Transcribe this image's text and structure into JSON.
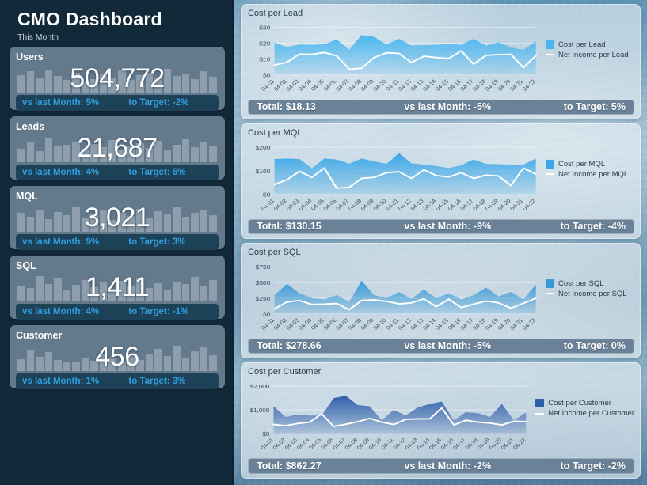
{
  "header": {
    "title": "CMO Dashboard",
    "subtitle": "This Month"
  },
  "colors": {
    "sidebar_bg": "#12293a",
    "card_bg": "#63798c",
    "card_footer_bg": "#1d4257",
    "card_footer_text": "#2f9fe0",
    "chart_footer_bg": "#6a8298",
    "accent_light_blue": "#4ab6f0",
    "accent_mid_blue": "#2f86c8",
    "accent_deep_blue": "#2f5fab",
    "line_color": "#ffffff"
  },
  "kpis": [
    {
      "title": "Users",
      "value": "504,772",
      "vs_last_month": "vs last Month: 5%",
      "to_target": "to Target: -2%",
      "spark": [
        62,
        74,
        52,
        80,
        58,
        45,
        70,
        36,
        48,
        66,
        54,
        78,
        44,
        60,
        70,
        50,
        82,
        58,
        66,
        46,
        74,
        56
      ]
    },
    {
      "title": "Leads",
      "value": "21,687",
      "vs_last_month": "vs last Month: 4%",
      "to_target": "to Target: 6%",
      "spark": [
        48,
        70,
        38,
        84,
        56,
        60,
        72,
        46,
        64,
        52,
        78,
        42,
        58,
        68,
        50,
        76,
        44,
        62,
        80,
        54,
        70,
        58
      ]
    },
    {
      "title": "MQL",
      "value": "3,021",
      "vs_last_month": "vs last Month: 9%",
      "to_target": "to Target: 3%",
      "spark": [
        66,
        52,
        78,
        44,
        70,
        58,
        86,
        50,
        64,
        74,
        42,
        68,
        56,
        80,
        46,
        72,
        60,
        88,
        54,
        66,
        76,
        58
      ]
    },
    {
      "title": "SQL",
      "value": "1,411",
      "vs_last_month": "vs last Month: 4%",
      "to_target": "to Target: -1%",
      "spark": [
        54,
        46,
        88,
        62,
        84,
        40,
        58,
        76,
        50,
        68,
        44,
        72,
        56,
        82,
        48,
        64,
        38,
        70,
        60,
        86,
        52,
        74
      ]
    },
    {
      "title": "Customer",
      "value": "456",
      "vs_last_month": "vs last Month: 1%",
      "to_target": "to Target: 3%",
      "spark": [
        42,
        74,
        50,
        66,
        38,
        34,
        30,
        46,
        36,
        58,
        44,
        30,
        52,
        40,
        62,
        78,
        54,
        88,
        48,
        70,
        84,
        56
      ]
    }
  ],
  "chart_data": [
    {
      "type": "area",
      "title": "Cost per Lead",
      "xlabel": "",
      "ylabel": "",
      "ylim": [
        0,
        32
      ],
      "yticks": [
        0,
        10,
        20,
        30
      ],
      "ytick_labels": [
        "$0",
        "$10",
        "$20",
        "$30"
      ],
      "grid": true,
      "legend_position": "right",
      "area_color": "#4ab6f0",
      "categories": [
        "04-01",
        "04-02",
        "04-03",
        "04-04",
        "04-05",
        "04-06",
        "04-07",
        "04-08",
        "04-09",
        "04-10",
        "04-11",
        "04-12",
        "04-13",
        "04-14",
        "04-15",
        "04-16",
        "04-17",
        "04-18",
        "04-19",
        "04-20",
        "04-21",
        "04-22"
      ],
      "series": [
        {
          "name": "Cost per Lead",
          "kind": "area",
          "values": [
            20.4,
            17.6,
            19.2,
            19.0,
            19.4,
            22.4,
            16.0,
            25.2,
            24.0,
            19.2,
            22.8,
            18.6,
            18.8,
            19.0,
            19.4,
            19.0,
            22.8,
            18.4,
            20.6,
            17.4,
            15.8,
            21.2
          ]
        },
        {
          "name": "Net Income per Lead",
          "kind": "line",
          "values": [
            6.2,
            8.0,
            13.2,
            13.0,
            14.2,
            12.0,
            3.6,
            4.2,
            11.0,
            14.0,
            13.6,
            7.8,
            11.8,
            11.0,
            10.4,
            15.2,
            6.8,
            12.4,
            12.8,
            13.0,
            4.6,
            12.2
          ]
        }
      ],
      "footer": {
        "total": "Total: $18.13",
        "vs_last_month": "vs last Month: -5%",
        "to_target": "to Target: 5%"
      }
    },
    {
      "type": "area",
      "title": "Cost per MQL",
      "xlabel": "",
      "ylabel": "",
      "ylim": [
        0,
        215
      ],
      "yticks": [
        0,
        100,
        200
      ],
      "ytick_labels": [
        "$0",
        "$100",
        "$200"
      ],
      "grid": true,
      "legend_position": "right",
      "area_color": "#3ca8e8",
      "categories": [
        "04-01",
        "04-02",
        "04-03",
        "04-04",
        "04-05",
        "04-06",
        "04-07",
        "04-08",
        "04-09",
        "04-10",
        "04-11",
        "04-12",
        "04-13",
        "04-14",
        "04-15",
        "04-16",
        "04-17",
        "04-18",
        "04-19",
        "04-20",
        "04-21",
        "04-22"
      ],
      "series": [
        {
          "name": "Cost per MQL",
          "kind": "area",
          "values": [
            150,
            152,
            150,
            110,
            152,
            148,
            130,
            152,
            140,
            130,
            175,
            132,
            126,
            120,
            112,
            124,
            148,
            130,
            128,
            126,
            126,
            152
          ]
        },
        {
          "name": "Net Income per MQL",
          "kind": "line",
          "values": [
            42,
            62,
            98,
            72,
            112,
            26,
            30,
            68,
            72,
            92,
            96,
            68,
            104,
            80,
            74,
            92,
            68,
            82,
            78,
            38,
            112,
            86
          ]
        }
      ],
      "footer": {
        "total": "Total: $130.15",
        "vs_last_month": "vs last Month: -9%",
        "to_target": "to Target: -4%"
      }
    },
    {
      "type": "area",
      "title": "Cost per SQL",
      "xlabel": "",
      "ylabel": "",
      "ylim": [
        0,
        810
      ],
      "yticks": [
        0,
        250,
        500,
        750
      ],
      "ytick_labels": [
        "$0",
        "$250",
        "$500",
        "$750"
      ],
      "grid": true,
      "legend_position": "right",
      "area_color": "#3a9ad8",
      "categories": [
        "04-01",
        "04-02",
        "04-03",
        "04-04",
        "04-05",
        "04-06",
        "04-07",
        "04-08",
        "04-09",
        "04-10",
        "04-11",
        "04-12",
        "04-13",
        "04-14",
        "04-15",
        "04-16",
        "04-17",
        "04-18",
        "04-19",
        "04-20",
        "04-21",
        "04-22"
      ],
      "series": [
        {
          "name": "Cost per SQL",
          "kind": "area",
          "values": [
            300,
            480,
            330,
            250,
            230,
            300,
            190,
            530,
            300,
            250,
            350,
            240,
            390,
            250,
            330,
            230,
            300,
            420,
            280,
            350,
            230,
            470
          ]
        },
        {
          "name": "Net Income per SQL",
          "kind": "line",
          "values": [
            80,
            190,
            215,
            150,
            155,
            165,
            65,
            215,
            225,
            200,
            160,
            175,
            240,
            115,
            235,
            100,
            155,
            205,
            175,
            90,
            170,
            250
          ]
        }
      ],
      "footer": {
        "total": "Total: $278.66",
        "vs_last_month": "vs last Month: -5%",
        "to_target": "to Target: 0%"
      }
    },
    {
      "type": "area",
      "title": "Cost per Customer",
      "xlabel": "",
      "ylabel": "",
      "ylim": [
        0,
        2150
      ],
      "yticks": [
        0,
        1000,
        2000
      ],
      "ytick_labels": [
        "$0",
        "$1,000",
        "$2,000"
      ],
      "grid": true,
      "legend_position": "right",
      "area_color": "#2f5fab",
      "categories": [
        "04-01",
        "04-02",
        "04-03",
        "04-04",
        "04-05",
        "04-06",
        "04-07",
        "04-08",
        "04-09",
        "04-10",
        "04-11",
        "04-12",
        "04-13",
        "04-14",
        "04-15",
        "04-16",
        "04-17",
        "04-18",
        "04-19",
        "04-20",
        "04-21",
        "04-22"
      ],
      "series": [
        {
          "name": "Cost per Customer",
          "kind": "area",
          "values": [
            1150,
            700,
            800,
            760,
            760,
            1500,
            1600,
            1200,
            1150,
            560,
            1000,
            760,
            1100,
            1250,
            1350,
            560,
            900,
            860,
            700,
            1250,
            560,
            880
          ]
        },
        {
          "name": "Net Income per Customer",
          "kind": "line",
          "values": [
            380,
            330,
            420,
            480,
            830,
            300,
            390,
            500,
            640,
            480,
            380,
            600,
            620,
            620,
            1080,
            360,
            560,
            480,
            440,
            360,
            520,
            500
          ]
        }
      ],
      "footer": {
        "total": "Total: $862.27",
        "vs_last_month": "vs last Month: -2%",
        "to_target": "to Target: -2%"
      }
    }
  ]
}
